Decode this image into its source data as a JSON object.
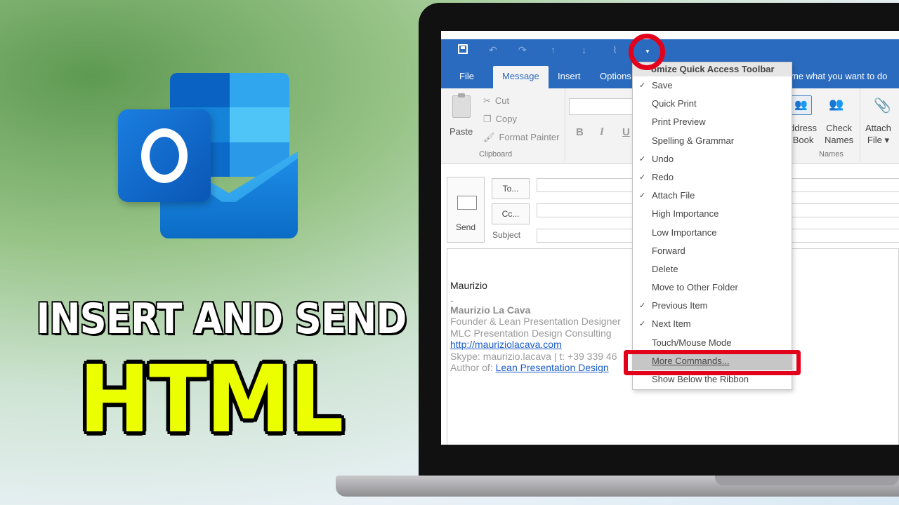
{
  "headline": {
    "line1": "INSERT AND SEND",
    "line2": "HTML"
  },
  "logo": {
    "letter": "O"
  },
  "ribbon_tabs": {
    "file": "File",
    "message": "Message",
    "insert": "Insert",
    "options": "Options",
    "tell_me": "me what you want to do"
  },
  "clipboard": {
    "paste": "Paste",
    "cut": "Cut",
    "copy": "Copy",
    "format_painter": "Format Painter",
    "group_label": "Clipboard"
  },
  "format": {
    "bold": "B",
    "italic": "I",
    "underline": "U"
  },
  "names_group": {
    "address_book": "Address Book",
    "address_book_line1": "ddress",
    "address_book_line2": "Book",
    "check_names_line1": "Check",
    "check_names_line2": "Names",
    "attach_line1": "Attach",
    "attach_line2": "File",
    "group_label": "Names"
  },
  "compose": {
    "send": "Send",
    "to": "To...",
    "cc": "Cc...",
    "subject": "Subject"
  },
  "body": {
    "greeting_name": "Maurizio",
    "dash": "-",
    "sig_name": "Maurizio La Cava",
    "sig_title": "Founder & Lean Presentation Designer",
    "sig_company": "MLC Presentation Design Consulting",
    "sig_url": "http://mauriziolacava.com",
    "sig_skype": "Skype: maurizio.lacava | t: +39 339 46",
    "sig_author_prefix": "Author of: ",
    "sig_author_link": "Lean Presentation Design"
  },
  "menu": {
    "title": "omize Quick Access Toolbar",
    "items": [
      {
        "label": "Save",
        "checked": true
      },
      {
        "label": "Quick Print",
        "checked": false
      },
      {
        "label": "Print Preview",
        "checked": false
      },
      {
        "label": "Spelling & Grammar",
        "checked": false
      },
      {
        "label": "Undo",
        "checked": true
      },
      {
        "label": "Redo",
        "checked": true
      },
      {
        "label": "Attach File",
        "checked": true
      },
      {
        "label": "High Importance",
        "checked": false
      },
      {
        "label": "Low Importance",
        "checked": false
      },
      {
        "label": "Forward",
        "checked": false
      },
      {
        "label": "Delete",
        "checked": false
      },
      {
        "label": "Move to Other Folder",
        "checked": false
      },
      {
        "label": "Previous Item",
        "checked": true
      },
      {
        "label": "Next Item",
        "checked": true
      },
      {
        "label": "Touch/Mouse Mode",
        "checked": false
      },
      {
        "label": "More Commands...",
        "checked": false,
        "highlighted": true
      },
      {
        "label": "Show Below the Ribbon",
        "checked": false
      }
    ],
    "check_glyph": "✓"
  },
  "colors": {
    "outlook_blue": "#2b6bbf",
    "highlight_red": "#e3001b",
    "headline_yellow": "#ecff00"
  }
}
